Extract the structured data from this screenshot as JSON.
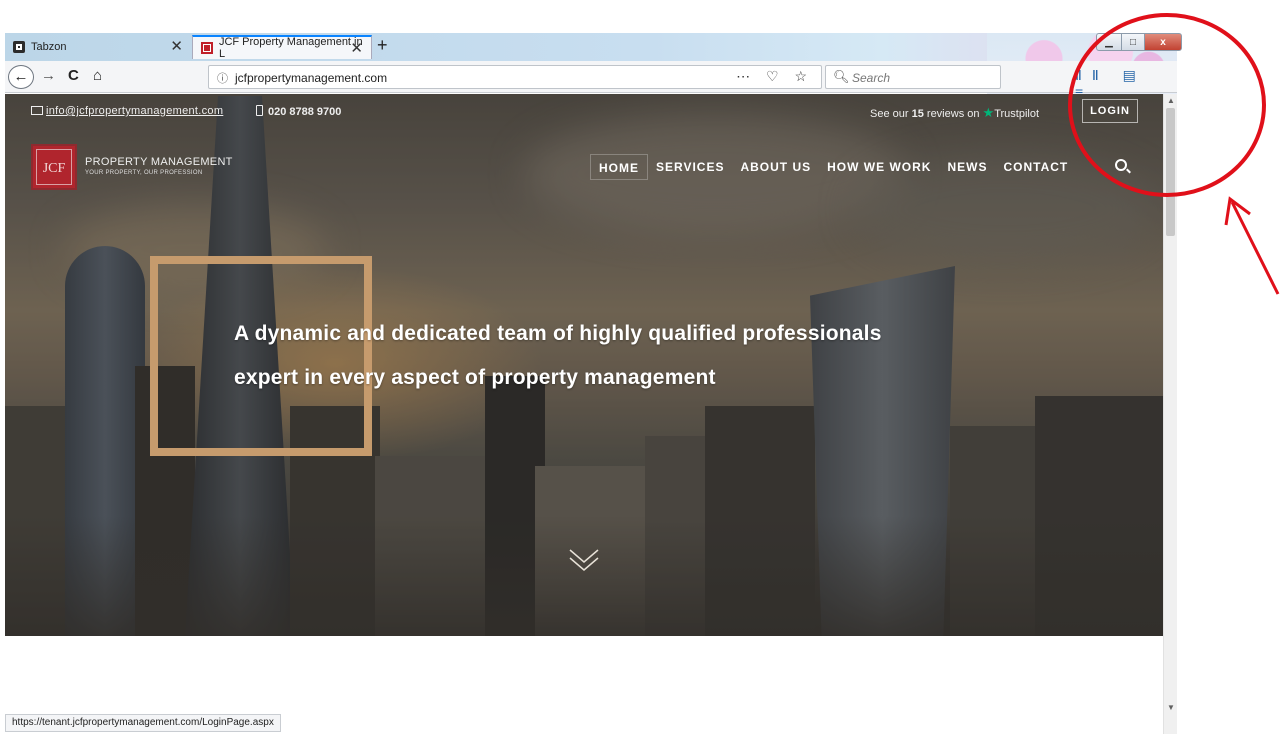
{
  "browser": {
    "tabs": [
      {
        "title": "Tabzon",
        "active": false
      },
      {
        "title": "JCF Property Management in L",
        "active": true
      }
    ],
    "new_tab_symbol": "+",
    "tab_close_symbol": "✕",
    "url_info_symbol": "ⓘ",
    "url": "jcfpropertymanagement.com",
    "url_actions": "⋯ ♡ ☆",
    "search_placeholder": "Search",
    "window_buttons": {
      "minimize": "▁",
      "maximize": "□",
      "close": "x"
    },
    "nav_symbols": {
      "back": "←",
      "forward": "→",
      "reload": "C",
      "home": "⌂"
    },
    "toolbar_icons": "ⅡⅡ ▤ ≡",
    "status_url": "https://tenant.jcfpropertymanagement.com/LoginPage.aspx"
  },
  "site": {
    "top_bar": {
      "email": "info@jcfpropertymanagement.com",
      "phone": "020 8788 9700",
      "reviews_prefix": "See our",
      "reviews_count": "15",
      "reviews_suffix": "reviews on",
      "trustpilot_star": "★",
      "trustpilot": "Trustpilot",
      "login": "LOGIN"
    },
    "logo": {
      "mark": "JCF",
      "name": "PROPERTY MANAGEMENT",
      "tagline": "YOUR PROPERTY, OUR PROFESSION"
    },
    "nav": [
      "HOME",
      "SERVICES",
      "ABOUT US",
      "HOW WE WORK",
      "NEWS",
      "CONTACT"
    ],
    "active_nav_index": 0,
    "hero": {
      "headline_line1": "A dynamic and dedicated team of highly qualified professionals",
      "headline_line2": "expert in every aspect of property management"
    }
  },
  "colors": {
    "accent_gold": "#c69b6d",
    "logo_red": "#b0252d",
    "trustpilot_green": "#00b67a",
    "annotation_red": "#e0101a"
  },
  "icons": [
    "envelope-icon",
    "phone-icon",
    "trustpilot-star-icon",
    "search-icon",
    "chevron-down-icon",
    "back-arrow-icon",
    "reload-icon",
    "home-icon",
    "info-icon",
    "pocket-icon",
    "bookmark-star-icon",
    "library-icon",
    "sidebar-icon",
    "hamburger-menu-icon"
  ]
}
